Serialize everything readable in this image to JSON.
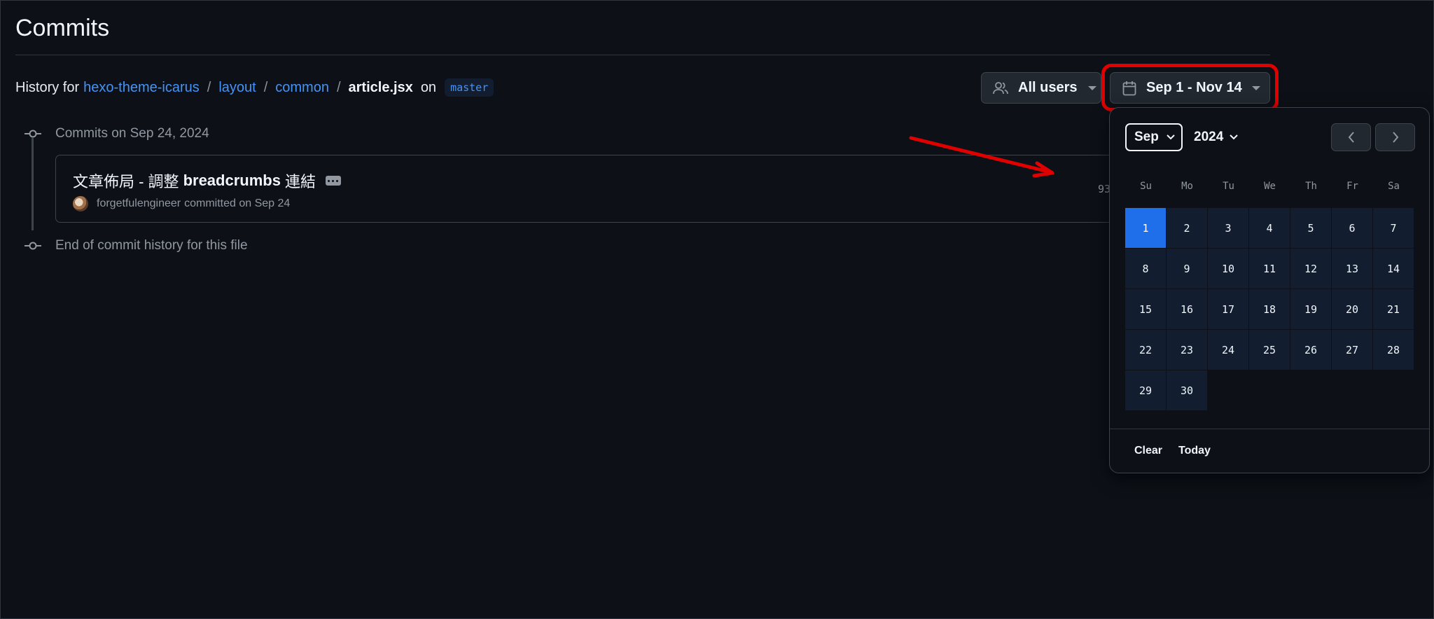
{
  "page_title": "Commits",
  "history": {
    "prefix": "History for",
    "repo": "hexo-theme-icarus",
    "dir1": "layout",
    "dir2": "common",
    "file": "article.jsx",
    "separator": "/",
    "on_text": "on",
    "branch": "master"
  },
  "filters": {
    "users_label": "All users",
    "date_label": "Sep 1 - Nov 14"
  },
  "timeline": {
    "group_label": "Commits on Sep 24, 2024",
    "end_label": "End of commit history for this file"
  },
  "commit": {
    "msg_prefix": "文章佈局 - 調整",
    "msg_bold": "breadcrumbs",
    "msg_suffix": "連結",
    "author": "forgetfulengineer",
    "committed_text": "committed on Sep 24",
    "sha_fragment": "93"
  },
  "calendar": {
    "month": "Sep",
    "year": "2024",
    "weekdays": [
      "Su",
      "Mo",
      "Tu",
      "We",
      "Th",
      "Fr",
      "Sa"
    ],
    "days": [
      "1",
      "2",
      "3",
      "4",
      "5",
      "6",
      "7",
      "8",
      "9",
      "10",
      "11",
      "12",
      "13",
      "14",
      "15",
      "16",
      "17",
      "18",
      "19",
      "20",
      "21",
      "22",
      "23",
      "24",
      "25",
      "26",
      "27",
      "28",
      "29",
      "30"
    ],
    "selected_day": "1",
    "clear_label": "Clear",
    "today_label": "Today"
  },
  "colors": {
    "accent": "#4493f8",
    "selected_day": "#1f6feb",
    "highlight": "#e00000"
  }
}
